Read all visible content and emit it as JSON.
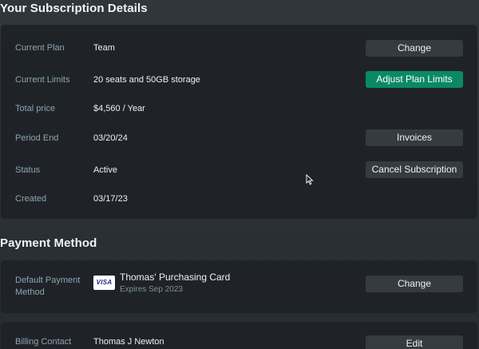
{
  "subscription": {
    "title": "Your Subscription Details",
    "rows": [
      {
        "label": "Current Plan",
        "value": "Team",
        "button": "Change"
      },
      {
        "label": "Current Limits",
        "value": "20 seats and 50GB storage",
        "button": "Adjust Plan Limits"
      },
      {
        "label": "Total price",
        "value": "$4,560 / Year"
      },
      {
        "label": "Period End",
        "value": "03/20/24",
        "button": "Invoices"
      },
      {
        "label": "Status",
        "value": "Active",
        "button": "Cancel Subscription"
      },
      {
        "label": "Created",
        "value": "03/17/23"
      }
    ]
  },
  "payment": {
    "title": "Payment Method",
    "default_label": "Default Payment Method",
    "default_label_line1": "Default Payment",
    "default_label_line2": "Method",
    "card_brand": "VISA",
    "card_name": "Thomas' Purchasing Card",
    "card_expiry": "Expires Sep 2023",
    "change_button": "Change"
  },
  "billing": {
    "label": "Billing Contact",
    "value": "Thomas J Newton",
    "edit_button": "Edit"
  },
  "colors": {
    "accent": "#0a8a64",
    "card_bg": "#1f2327",
    "button_bg": "#353b40",
    "label": "#8ea3b5"
  },
  "icons": {
    "card_brand_icon": "visa-card-icon",
    "cursor": "mouse-pointer-icon"
  }
}
